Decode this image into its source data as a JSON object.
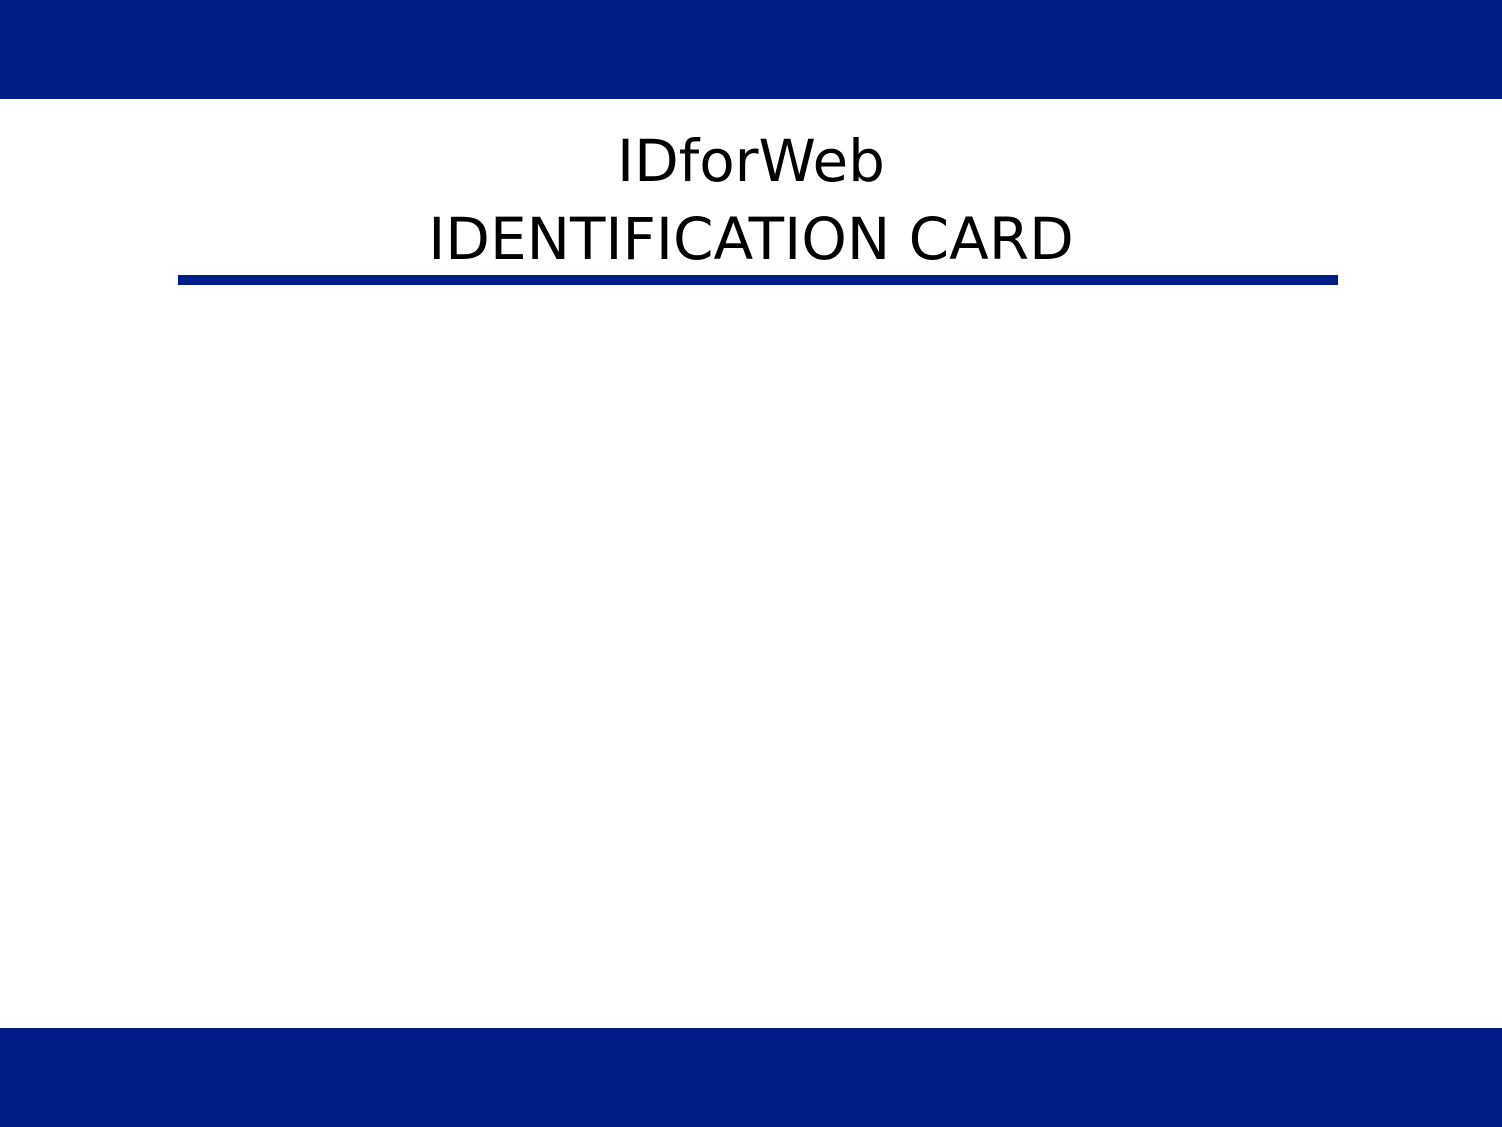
{
  "card": {
    "app_name": "IDforWeb",
    "card_title": "IDENTIFICATION CARD"
  },
  "colors": {
    "brand_navy": "#001C87",
    "background": "#FFFFFF",
    "text": "#000000"
  }
}
